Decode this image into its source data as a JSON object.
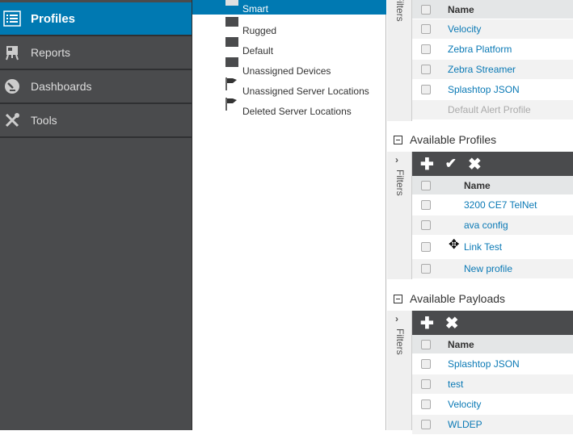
{
  "sidebar": {
    "items": [
      {
        "label": "Profiles",
        "icon": "list-icon",
        "active": true
      },
      {
        "label": "Reports",
        "icon": "easel-icon"
      },
      {
        "label": "Dashboards",
        "icon": "gauge-icon"
      },
      {
        "label": "Tools",
        "icon": "tools-icon"
      }
    ]
  },
  "tree": {
    "items": [
      {
        "label": "Smart",
        "icon": "folder-icon",
        "selected": true
      },
      {
        "label": "Rugged",
        "icon": "folder-icon"
      },
      {
        "label": "Default",
        "icon": "folder-icon"
      },
      {
        "label": "Unassigned Devices",
        "icon": "folder-icon"
      },
      {
        "label": "Unassigned Server Locations",
        "icon": "flag-icon"
      },
      {
        "label": "Deleted Server Locations",
        "icon": "flag-icon"
      }
    ]
  },
  "alerts": {
    "filters_label": "Filters",
    "name_header": "Name",
    "rows": [
      "Velocity",
      "Zebra Platform",
      "Zebra Streamer",
      "Splashtop JSON"
    ],
    "disabled_row": "Default Alert Profile"
  },
  "profiles": {
    "title": "Available Profiles",
    "filters_label": "Filters",
    "name_header": "Name",
    "rows": [
      "3200 CE7 TelNet",
      "ava config",
      "Link Test",
      "New profile"
    ]
  },
  "payloads": {
    "title": "Available Payloads",
    "filters_label": "Filters",
    "name_header": "Name",
    "rows": [
      "Splashtop JSON",
      "test",
      "Velocity",
      "WLDEP"
    ]
  },
  "colors": {
    "accent": "#0079b2",
    "sidebar": "#4a4b4d",
    "link": "#0a79b5"
  }
}
